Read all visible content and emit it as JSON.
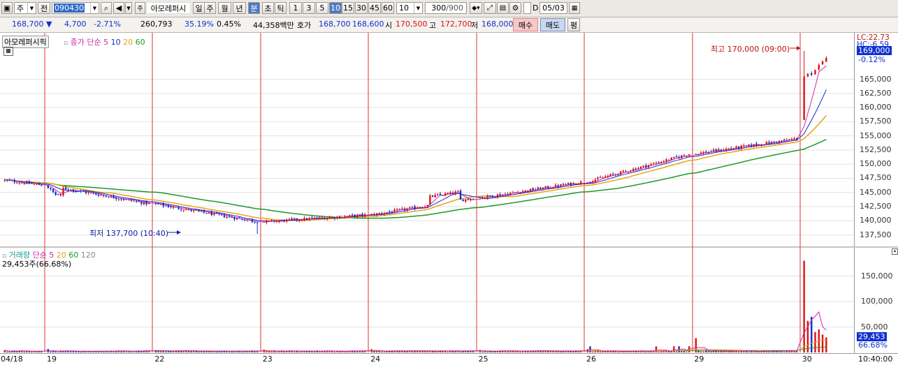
{
  "toolbar": {
    "market": "주",
    "code_prefix": "전",
    "stock_code": "090430",
    "stock_name": "아모레퍼시",
    "periods": [
      "일",
      "주",
      "월",
      "년",
      "분",
      "초",
      "틱"
    ],
    "active_period": "분",
    "intervals": [
      "1",
      "3",
      "5",
      "10",
      "15",
      "30",
      "45",
      "60"
    ],
    "active_interval": "10",
    "interval_value": "10",
    "count_value": "300",
    "count_total": "/900",
    "d_label": "D",
    "date_value": "05/03"
  },
  "quote": {
    "price": "168,700",
    "change": "4,700",
    "change_pct": "-2.71%",
    "volume": "260,793",
    "turnover_pct": "35.19%",
    "v_pct": "0.45%",
    "amount": "44,358백만",
    "hoga_label": "호가",
    "ask": "168,700",
    "bid": "168,600",
    "open_label": "시",
    "open": "170,500",
    "high_label": "고",
    "high": "172,700",
    "low_label": "저",
    "low": "168,000",
    "buy_label": "매수",
    "sell_label": "매도",
    "avg_label": "평"
  },
  "price_panel": {
    "title_box": "아모레퍼시픽",
    "legend_name": "종가 단순",
    "ma_periods": [
      "5",
      "10",
      "20",
      "60"
    ],
    "ma_colors": [
      "#cc2aa8",
      "#1a2ccc",
      "#e8a418",
      "#1a9a2a"
    ],
    "high_annotation": "최고 170,000 (09:00)",
    "low_annotation": "최저 137,700 (10:40)",
    "lc_label": "LC:22.73",
    "hc_label": "HC:-6.59",
    "current_price_tag": "169,000",
    "current_change_tag": "-0.12%",
    "yticks": [
      "165,000",
      "162,500",
      "160,000",
      "157,500",
      "155,000",
      "152,500",
      "150,000",
      "147,500",
      "145,000",
      "142,500",
      "140,000",
      "137,500"
    ]
  },
  "volume_panel": {
    "legend_name": "거래량",
    "legend_ma_label": "단순",
    "ma_periods": [
      "5",
      "20",
      "60",
      "120"
    ],
    "volume_text": "29,453주(66.68%)",
    "current_volume_tag": "29,453",
    "current_pct_tag": "66.68%",
    "yticks": [
      "150,000",
      "100,000",
      "50,000"
    ]
  },
  "xaxis": {
    "labels": [
      "04/18",
      "19",
      "22",
      "23",
      "24",
      "25",
      "26",
      "29",
      "30"
    ],
    "time_label": "10:40:00"
  },
  "colors": {
    "up": "#e01010",
    "down": "#1030d0",
    "divider": "#e03030"
  },
  "chart_data": {
    "type": "candlestick",
    "interval": "10 minute",
    "days": [
      "04/18",
      "04/19",
      "04/22",
      "04/23",
      "04/24",
      "04/25",
      "04/26",
      "04/29",
      "04/30"
    ],
    "day_close_path": [
      {
        "day": "04/18",
        "open": 147200,
        "close": 146300
      },
      {
        "day": "04/19",
        "open": 146300,
        "close": 143000
      },
      {
        "day": "04/22",
        "open": 143000,
        "close": 139800
      },
      {
        "day": "04/23",
        "open": 139800,
        "close": 141000
      },
      {
        "day": "04/24",
        "open": 141000,
        "close": 144000
      },
      {
        "day": "04/25",
        "open": 144000,
        "close": 146800
      },
      {
        "day": "04/26",
        "open": 146800,
        "close": 151800
      },
      {
        "day": "04/29",
        "open": 151800,
        "close": 154500
      },
      {
        "day": "04/30",
        "open": 154500,
        "close": 169000
      }
    ],
    "high": 170000,
    "low": 137700,
    "yrange": [
      135600,
      173200
    ],
    "volume_range": [
      0,
      185000
    ],
    "volume_peak": 180000,
    "latest_volume": 29453
  }
}
